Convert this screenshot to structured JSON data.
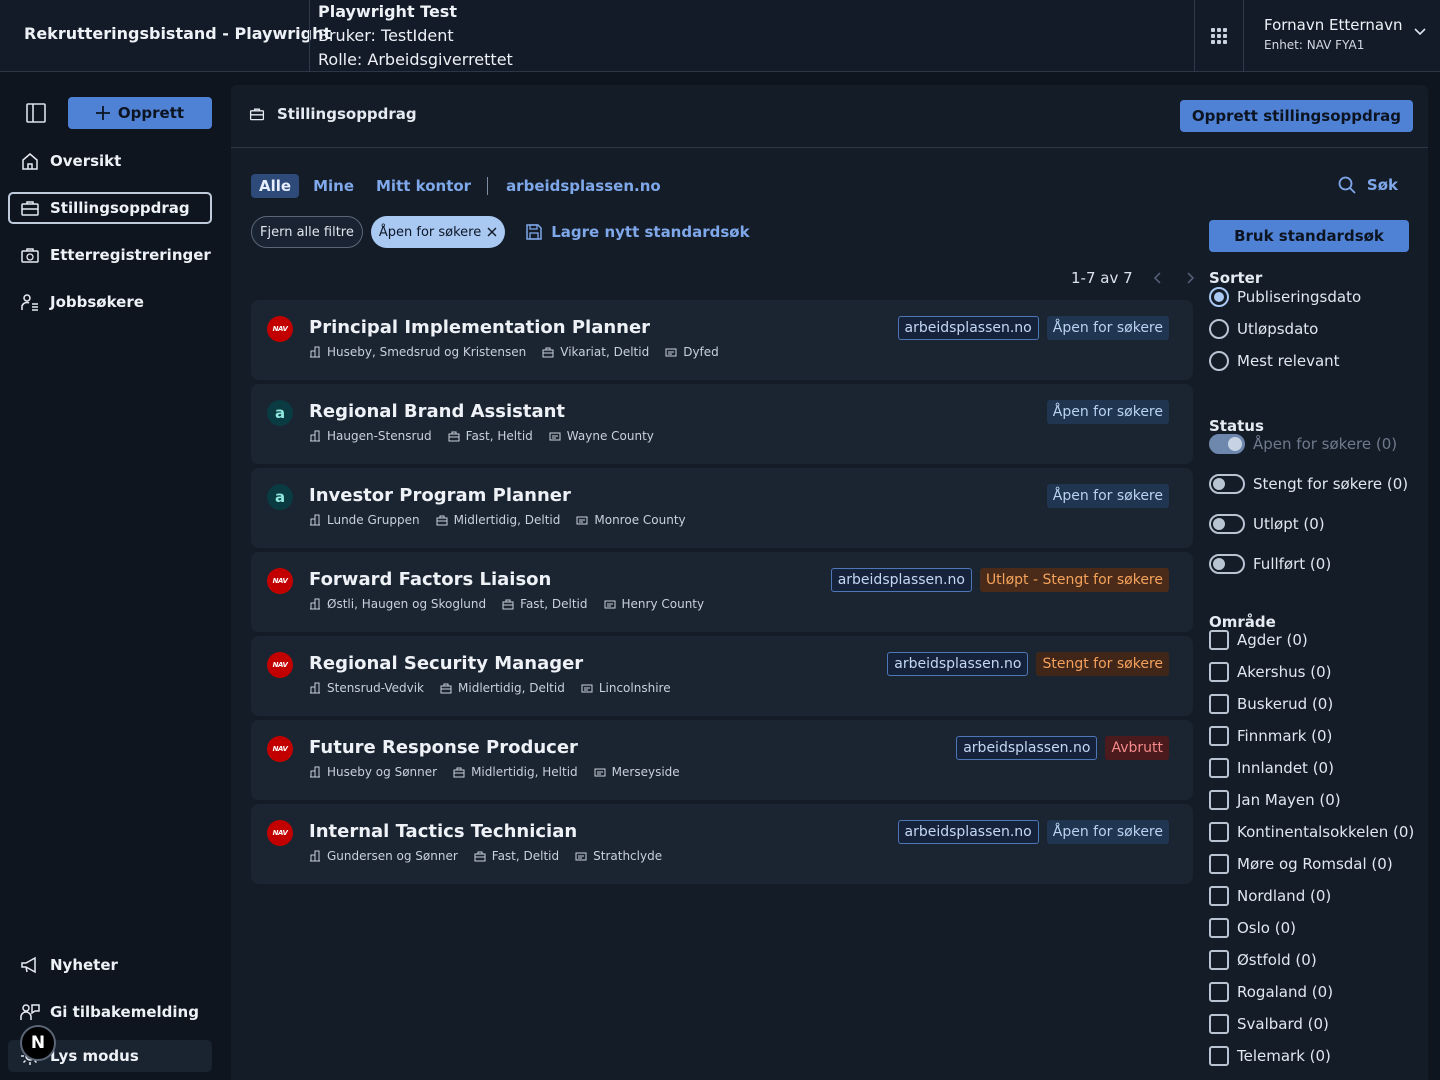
{
  "header": {
    "app_title": "Rekrutteringsbistand - Playwright",
    "dev_title": "Playwright Test",
    "dev_user": "Bruker: TestIdent",
    "dev_role": "Rolle: Arbeidsgiverrettet",
    "user_name": "Fornavn Etternavn",
    "user_unit": "Enhet: NAV FYA1"
  },
  "sidebar": {
    "create_label": "Opprett",
    "items": [
      {
        "label": "Oversikt",
        "icon": "house-icon"
      },
      {
        "label": "Stillingsoppdrag",
        "icon": "briefcase-icon"
      },
      {
        "label": "Etterregistreringer",
        "icon": "briefcase-clock-icon"
      },
      {
        "label": "Jobbsøkere",
        "icon": "person-group-icon"
      }
    ],
    "bottom_items": [
      {
        "label": "Nyheter",
        "icon": "megaphone-icon"
      },
      {
        "label": "Gi tilbakemelding",
        "icon": "feedback-icon"
      },
      {
        "label": "Lys modus",
        "icon": "sun-icon"
      }
    ],
    "avatar_letter": "N"
  },
  "main": {
    "title": "Stillingsoppdrag",
    "create_assignment_label": "Opprett stillingsoppdrag",
    "tabs": [
      "Alle",
      "Mine",
      "Mitt kontor",
      "arbeidsplassen.no"
    ],
    "search_label": "Søk",
    "chip_remove_all": "Fjern alle filtre",
    "chip_active": "Åpen for søkere",
    "save_search_label": "Lagre nytt standardsøk",
    "pager_text": "1-7 av 7"
  },
  "jobs": [
    {
      "title": "Principal Implementation Planner",
      "logo": "nav",
      "employer": "Huseby, Smedsrud og Kristensen",
      "type": "Vikariat, Deltid",
      "location": "Dyfed",
      "source": "arbeidsplassen.no",
      "status": "Åpen for søkere",
      "status_kind": "open"
    },
    {
      "title": "Regional Brand Assistant",
      "logo": "ap",
      "employer": "Haugen-Stensrud",
      "type": "Fast, Heltid",
      "location": "Wayne County",
      "source": "",
      "status": "Åpen for søkere",
      "status_kind": "open"
    },
    {
      "title": "Investor Program Planner",
      "logo": "ap",
      "employer": "Lunde Gruppen",
      "type": "Midlertidig, Deltid",
      "location": "Monroe County",
      "source": "",
      "status": "Åpen for søkere",
      "status_kind": "open"
    },
    {
      "title": "Forward Factors Liaison",
      "logo": "nav",
      "employer": "Østli, Haugen og Skoglund",
      "type": "Fast, Deltid",
      "location": "Henry County",
      "source": "arbeidsplassen.no",
      "status": "Utløpt - Stengt for søkere",
      "status_kind": "expired"
    },
    {
      "title": "Regional Security Manager",
      "logo": "nav",
      "employer": "Stensrud-Vedvik",
      "type": "Midlertidig, Deltid",
      "location": "Lincolnshire",
      "source": "arbeidsplassen.no",
      "status": "Stengt for søkere",
      "status_kind": "closed"
    },
    {
      "title": "Future Response Producer",
      "logo": "nav",
      "employer": "Huseby og Sønner",
      "type": "Midlertidig, Heltid",
      "location": "Merseyside",
      "source": "arbeidsplassen.no",
      "status": "Avbrutt",
      "status_kind": "aborted"
    },
    {
      "title": "Internal Tactics Technician",
      "logo": "nav",
      "employer": "Gundersen og Sønner",
      "type": "Fast, Deltid",
      "location": "Strathclyde",
      "source": "arbeidsplassen.no",
      "status": "Åpen for søkere",
      "status_kind": "open"
    }
  ],
  "logos": {
    "nav": "NAV",
    "ap": "a"
  },
  "filters": {
    "std_search_label": "Bruk standardsøk",
    "sort_label": "Sorter",
    "sort_options": [
      "Publiseringsdato",
      "Utløpsdato",
      "Mest relevant"
    ],
    "sort_selected": 0,
    "status_label": "Status",
    "status_options": [
      {
        "label": "Åpen for søkere (0)",
        "on": true,
        "disabled": true
      },
      {
        "label": "Stengt for søkere (0)",
        "on": false,
        "disabled": false
      },
      {
        "label": "Utløpt (0)",
        "on": false,
        "disabled": false
      },
      {
        "label": "Fullført (0)",
        "on": false,
        "disabled": false
      }
    ],
    "area_label": "Område",
    "area_options": [
      "Agder (0)",
      "Akershus (0)",
      "Buskerud (0)",
      "Finnmark (0)",
      "Innlandet (0)",
      "Jan Mayen (0)",
      "Kontinentalsokkelen (0)",
      "Møre og Romsdal (0)",
      "Nordland (0)",
      "Oslo (0)",
      "Østfold (0)",
      "Rogaland (0)",
      "Svalbard (0)",
      "Telemark (0)"
    ]
  },
  "colors": {
    "accent": "#4f82d4",
    "background": "#0e151f",
    "panel": "#141c28",
    "card": "#1b2431"
  }
}
